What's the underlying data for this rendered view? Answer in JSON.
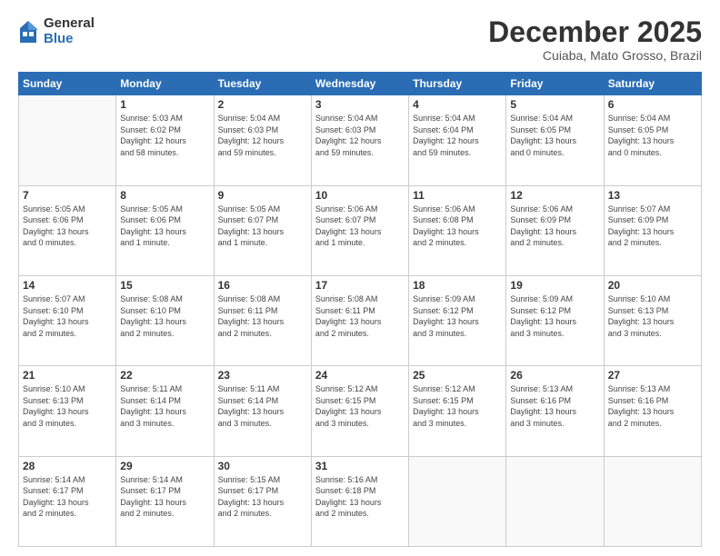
{
  "header": {
    "logo_general": "General",
    "logo_blue": "Blue",
    "month_title": "December 2025",
    "location": "Cuiaba, Mato Grosso, Brazil"
  },
  "days_of_week": [
    "Sunday",
    "Monday",
    "Tuesday",
    "Wednesday",
    "Thursday",
    "Friday",
    "Saturday"
  ],
  "weeks": [
    [
      {
        "num": "",
        "info": ""
      },
      {
        "num": "1",
        "info": "Sunrise: 5:03 AM\nSunset: 6:02 PM\nDaylight: 12 hours\nand 58 minutes."
      },
      {
        "num": "2",
        "info": "Sunrise: 5:04 AM\nSunset: 6:03 PM\nDaylight: 12 hours\nand 59 minutes."
      },
      {
        "num": "3",
        "info": "Sunrise: 5:04 AM\nSunset: 6:03 PM\nDaylight: 12 hours\nand 59 minutes."
      },
      {
        "num": "4",
        "info": "Sunrise: 5:04 AM\nSunset: 6:04 PM\nDaylight: 12 hours\nand 59 minutes."
      },
      {
        "num": "5",
        "info": "Sunrise: 5:04 AM\nSunset: 6:05 PM\nDaylight: 13 hours\nand 0 minutes."
      },
      {
        "num": "6",
        "info": "Sunrise: 5:04 AM\nSunset: 6:05 PM\nDaylight: 13 hours\nand 0 minutes."
      }
    ],
    [
      {
        "num": "7",
        "info": "Sunrise: 5:05 AM\nSunset: 6:06 PM\nDaylight: 13 hours\nand 0 minutes."
      },
      {
        "num": "8",
        "info": "Sunrise: 5:05 AM\nSunset: 6:06 PM\nDaylight: 13 hours\nand 1 minute."
      },
      {
        "num": "9",
        "info": "Sunrise: 5:05 AM\nSunset: 6:07 PM\nDaylight: 13 hours\nand 1 minute."
      },
      {
        "num": "10",
        "info": "Sunrise: 5:06 AM\nSunset: 6:07 PM\nDaylight: 13 hours\nand 1 minute."
      },
      {
        "num": "11",
        "info": "Sunrise: 5:06 AM\nSunset: 6:08 PM\nDaylight: 13 hours\nand 2 minutes."
      },
      {
        "num": "12",
        "info": "Sunrise: 5:06 AM\nSunset: 6:09 PM\nDaylight: 13 hours\nand 2 minutes."
      },
      {
        "num": "13",
        "info": "Sunrise: 5:07 AM\nSunset: 6:09 PM\nDaylight: 13 hours\nand 2 minutes."
      }
    ],
    [
      {
        "num": "14",
        "info": "Sunrise: 5:07 AM\nSunset: 6:10 PM\nDaylight: 13 hours\nand 2 minutes."
      },
      {
        "num": "15",
        "info": "Sunrise: 5:08 AM\nSunset: 6:10 PM\nDaylight: 13 hours\nand 2 minutes."
      },
      {
        "num": "16",
        "info": "Sunrise: 5:08 AM\nSunset: 6:11 PM\nDaylight: 13 hours\nand 2 minutes."
      },
      {
        "num": "17",
        "info": "Sunrise: 5:08 AM\nSunset: 6:11 PM\nDaylight: 13 hours\nand 2 minutes."
      },
      {
        "num": "18",
        "info": "Sunrise: 5:09 AM\nSunset: 6:12 PM\nDaylight: 13 hours\nand 3 minutes."
      },
      {
        "num": "19",
        "info": "Sunrise: 5:09 AM\nSunset: 6:12 PM\nDaylight: 13 hours\nand 3 minutes."
      },
      {
        "num": "20",
        "info": "Sunrise: 5:10 AM\nSunset: 6:13 PM\nDaylight: 13 hours\nand 3 minutes."
      }
    ],
    [
      {
        "num": "21",
        "info": "Sunrise: 5:10 AM\nSunset: 6:13 PM\nDaylight: 13 hours\nand 3 minutes."
      },
      {
        "num": "22",
        "info": "Sunrise: 5:11 AM\nSunset: 6:14 PM\nDaylight: 13 hours\nand 3 minutes."
      },
      {
        "num": "23",
        "info": "Sunrise: 5:11 AM\nSunset: 6:14 PM\nDaylight: 13 hours\nand 3 minutes."
      },
      {
        "num": "24",
        "info": "Sunrise: 5:12 AM\nSunset: 6:15 PM\nDaylight: 13 hours\nand 3 minutes."
      },
      {
        "num": "25",
        "info": "Sunrise: 5:12 AM\nSunset: 6:15 PM\nDaylight: 13 hours\nand 3 minutes."
      },
      {
        "num": "26",
        "info": "Sunrise: 5:13 AM\nSunset: 6:16 PM\nDaylight: 13 hours\nand 3 minutes."
      },
      {
        "num": "27",
        "info": "Sunrise: 5:13 AM\nSunset: 6:16 PM\nDaylight: 13 hours\nand 2 minutes."
      }
    ],
    [
      {
        "num": "28",
        "info": "Sunrise: 5:14 AM\nSunset: 6:17 PM\nDaylight: 13 hours\nand 2 minutes."
      },
      {
        "num": "29",
        "info": "Sunrise: 5:14 AM\nSunset: 6:17 PM\nDaylight: 13 hours\nand 2 minutes."
      },
      {
        "num": "30",
        "info": "Sunrise: 5:15 AM\nSunset: 6:17 PM\nDaylight: 13 hours\nand 2 minutes."
      },
      {
        "num": "31",
        "info": "Sunrise: 5:16 AM\nSunset: 6:18 PM\nDaylight: 13 hours\nand 2 minutes."
      },
      {
        "num": "",
        "info": ""
      },
      {
        "num": "",
        "info": ""
      },
      {
        "num": "",
        "info": ""
      }
    ]
  ]
}
